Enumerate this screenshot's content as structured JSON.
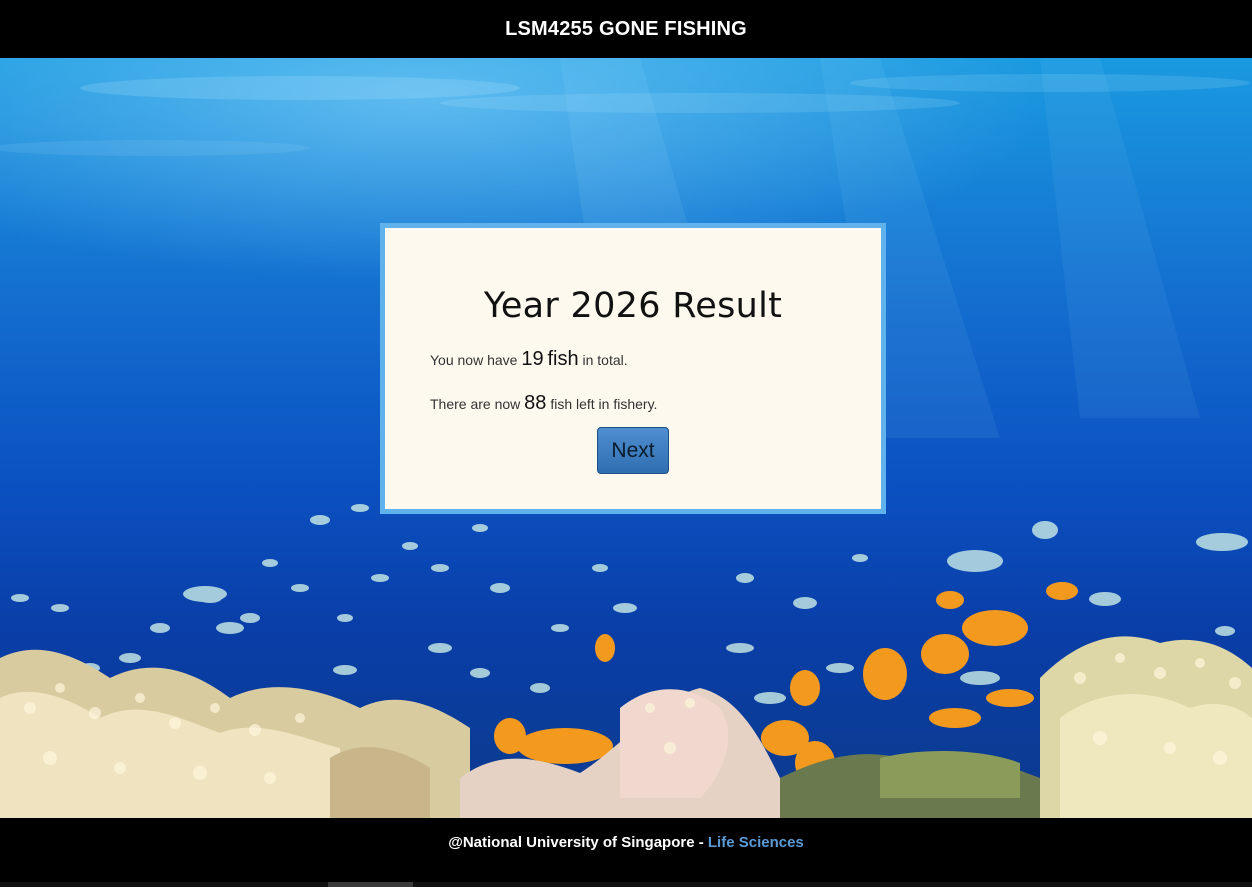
{
  "header": {
    "title": "LSM4255 GONE FISHING"
  },
  "result": {
    "title": "Year 2026 Result",
    "fish_total_prefix": "You now have",
    "fish_total_value": "19",
    "fish_total_unit": "fish",
    "fish_total_suffix": "in total.",
    "fishery_prefix": "There are now",
    "fishery_value": "88",
    "fishery_suffix": "fish left in fishery.",
    "next_label": "Next"
  },
  "footer": {
    "text": "@National University of Singapore - ",
    "link_label": "Life Sciences"
  },
  "colors": {
    "box_border": "#5fb2ec",
    "box_background": "#fdf9ef",
    "button": "#3a7bbf",
    "footer_link": "#5b9bd5"
  }
}
